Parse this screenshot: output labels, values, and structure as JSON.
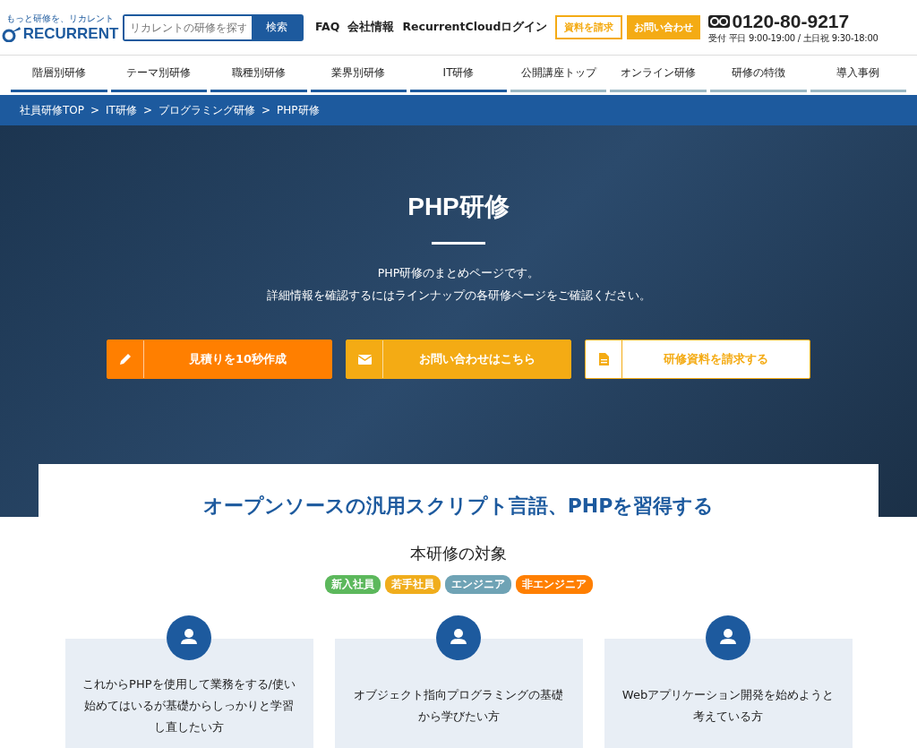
{
  "header": {
    "logo_tagline": "もっと研修を、リカレント",
    "logo_text": "RECURRENT",
    "search": {
      "placeholder": "リカレントの研修を探す",
      "button": "検索"
    },
    "links": [
      "FAQ",
      "会社情報",
      "RecurrentCloudログイン"
    ],
    "request_button": "資料を請求",
    "contact_button": "お問い合わせ",
    "phone": "0120-80-9217",
    "hours": "受付 平日 9:00-19:00 / 土日祝 9:30-18:00"
  },
  "nav": [
    {
      "label": "階層別研修",
      "color": "#1d5a9e"
    },
    {
      "label": "テーマ別研修",
      "color": "#1d5a9e"
    },
    {
      "label": "職種別研修",
      "color": "#1d5a9e"
    },
    {
      "label": "業界別研修",
      "color": "#1d5a9e"
    },
    {
      "label": "IT研修",
      "color": "#1d5a9e"
    },
    {
      "label": "公開講座トップ",
      "color": "#9bb8c4"
    },
    {
      "label": "オンライン研修",
      "color": "#9bb8c4"
    },
    {
      "label": "研修の特徴",
      "color": "#9bb8c4"
    },
    {
      "label": "導入事例",
      "color": "#9bb8c4"
    }
  ],
  "breadcrumb": [
    "社員研修TOP",
    ">",
    "IT研修",
    ">",
    "プログラミング研修",
    ">",
    "PHP研修"
  ],
  "hero": {
    "title": "PHP研修",
    "lines": [
      "PHP研修のまとめページです。",
      "詳細情報を確認するにはラインナップの各研修ページをご確認ください。"
    ],
    "buttons": [
      {
        "kind": "estimate",
        "label": "見積りを10秒作成"
      },
      {
        "kind": "contact",
        "label": "お問い合わせはこちら"
      },
      {
        "kind": "document",
        "label": "研修資料を請求する"
      }
    ]
  },
  "intro": {
    "heading": "オープンソースの汎用スクリプト言語、PHPを習得する",
    "target_title": "本研修の対象",
    "tags": [
      {
        "label": "新入社員",
        "color": "#5cb85c"
      },
      {
        "label": "若手社員",
        "color": "#f0ad1c"
      },
      {
        "label": "エンジニア",
        "color": "#6fa3b5"
      },
      {
        "label": "非エンジニア",
        "color": "#ff7f00"
      }
    ],
    "targets": [
      {
        "text": "これからPHPを使用して業務をする/使い始めてはいるが基礎からしっかりと学習し直したい方"
      },
      {
        "text": "オブジェクト指向プログラミングの基礎から学びたい方"
      },
      {
        "text": "Webアプリケーション開発を始めようと考えている方"
      }
    ]
  }
}
